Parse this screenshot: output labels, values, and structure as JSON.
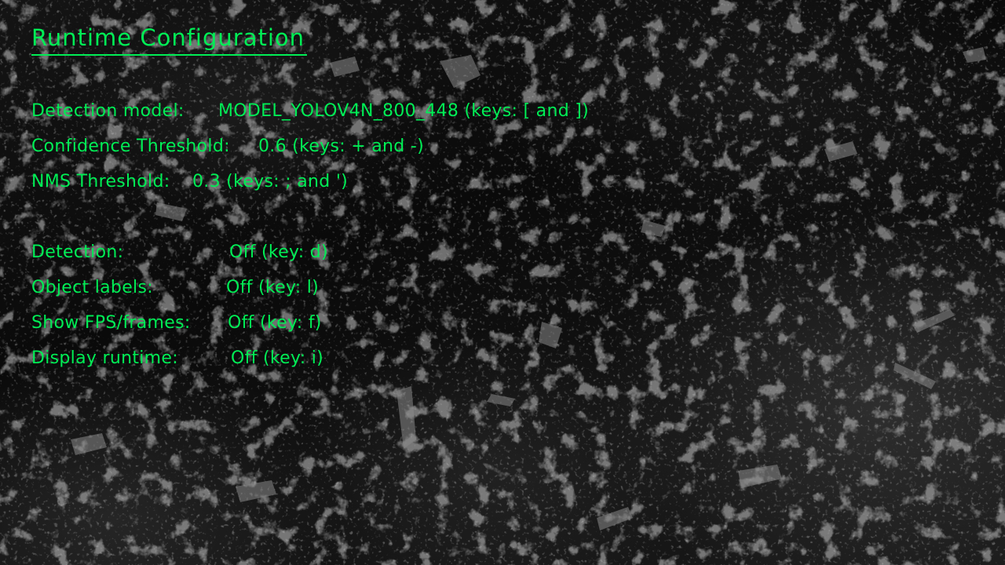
{
  "title": "Runtime Configuration",
  "settings": [
    {
      "label": "Detection model:",
      "value": "MODEL_YOLOV4N_800_448 (keys: [ and ])"
    },
    {
      "label": "Confidence Threshold:",
      "value": "0.6 (keys: + and -)"
    },
    {
      "label": "NMS Threshold:",
      "value": "0.3 (keys: ; and ')"
    }
  ],
  "toggles": [
    {
      "label": "Detection:",
      "value": "Off (key: d)"
    },
    {
      "label": "Object labels:",
      "value": "Off (key: l)"
    },
    {
      "label": "Show FPS/frames:",
      "value": "Off (key: f)"
    },
    {
      "label": "Display runtime:",
      "value": "Off (key: i)"
    }
  ],
  "colors": {
    "text": "#00ee55",
    "background": "#0b0b0b"
  }
}
